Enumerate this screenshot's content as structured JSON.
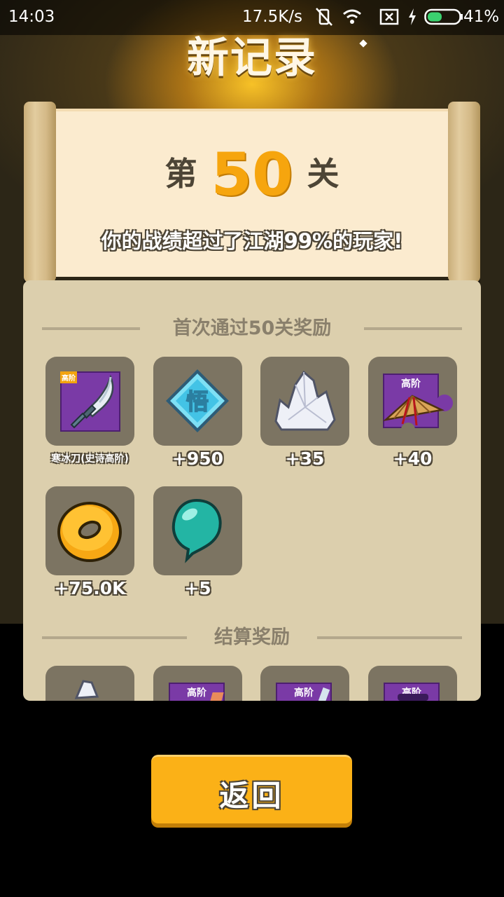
{
  "status_bar": {
    "time": "14:03",
    "net_speed": "17.5K/s",
    "battery": "41%",
    "icons": [
      "vibrate-off-icon",
      "wifi-icon",
      "sim-x-icon",
      "charging-icon",
      "battery-icon"
    ]
  },
  "title": "新记录",
  "stage": {
    "prefix": "第",
    "number": "50",
    "suffix": "关",
    "description": "你的战绩超过了江湖99%的玩家!"
  },
  "first_clear": {
    "title": "首次通过50关奖励",
    "rewards": [
      {
        "icon": "ice-blade-icon",
        "label": "寒冰刀(史诗高阶)",
        "tag": "高阶"
      },
      {
        "icon": "enlightenment-gem-icon",
        "label": "+950",
        "glyph": "悟"
      },
      {
        "icon": "crystal-icon",
        "label": "+35"
      },
      {
        "icon": "bamboo-hat-fragment-icon",
        "label": "+40",
        "tag": "高阶"
      },
      {
        "icon": "gold-coin-icon",
        "label": "+75.0K"
      },
      {
        "icon": "jade-bead-icon",
        "label": "+5"
      }
    ]
  },
  "settlement": {
    "title": "结算奖励",
    "rewards": [
      {
        "icon": "crystal-icon"
      },
      {
        "icon": "scroll-fragment-icon",
        "tag": "高阶"
      },
      {
        "icon": "blade-fragment-icon",
        "tag": "高阶"
      },
      {
        "icon": "mask-fragment-icon",
        "tag": "高阶"
      }
    ]
  },
  "back_button": "返回",
  "colors": {
    "accent": "#f6a50e",
    "button": "#fbb117",
    "panel": "#dccfad",
    "paper": "#fbebcf",
    "item_bg": "#7c7462",
    "epic": "#7a3aa6"
  }
}
